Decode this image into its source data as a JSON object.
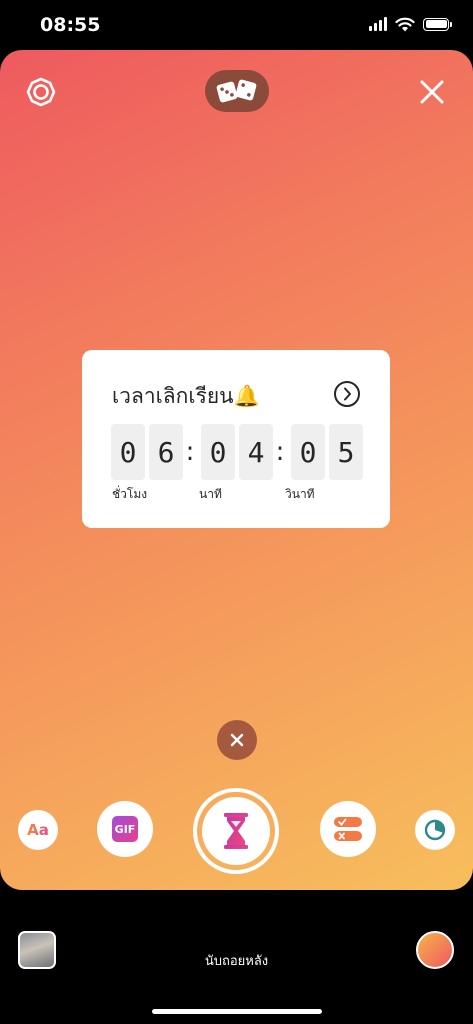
{
  "status_bar": {
    "time": "08:55"
  },
  "colors": {
    "canvas_gradient": [
      "#ee5a5f",
      "#f27b5d",
      "#f59a5c",
      "#f7be5c"
    ],
    "dice_pill": "#8b4a3a",
    "dismiss": "#a55a3f",
    "accent_pink": "#e8418d"
  },
  "top_controls": {
    "settings": "settings-icon",
    "random": "dice-icon",
    "close": "close-icon"
  },
  "countdown": {
    "title": "เวลาเลิกเรียน🔔",
    "digits": [
      "0",
      "6",
      "0",
      "4",
      "0",
      "5"
    ],
    "separator": ":",
    "units": {
      "hours": "ชั่วโมง",
      "minutes": "นาที",
      "seconds": "วินาที"
    },
    "next_icon": "chevron-right-circle-icon"
  },
  "sticker_tray": {
    "text_label": "Aa",
    "gif_label": "GIF",
    "selected": "countdown-hourglass-icon",
    "qna": "checklist-icon",
    "poll": "pie-chart-icon"
  },
  "bottom_bar": {
    "mode_label": "นับถอยหลัง"
  }
}
